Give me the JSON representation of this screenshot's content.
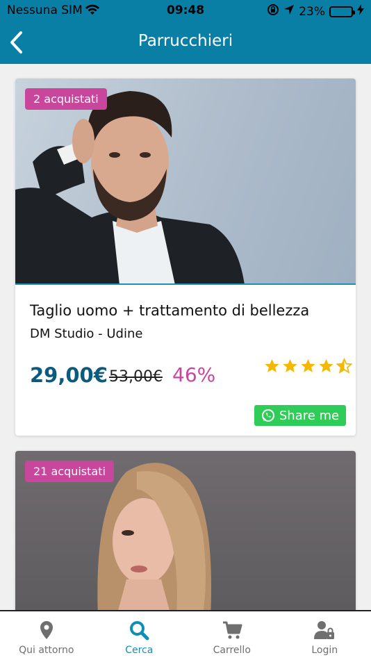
{
  "status_bar": {
    "carrier": "Nessuna SIM",
    "time": "09:48",
    "battery": "23%"
  },
  "header": {
    "title": "Parrucchieri",
    "back_icon": "chevron-left-icon"
  },
  "colors": {
    "brand": "#0a7fa6",
    "badge": "#c8469c",
    "price": "#0d5a7d",
    "share": "#2fcc57",
    "stars": "#f5b800",
    "tab_active": "#0f8fb8",
    "tab_inactive": "#6f6f6f"
  },
  "deals": [
    {
      "badge": "2 acquistati",
      "title": "Taglio uomo + trattamento di bellezza",
      "subtitle": "DM Studio - Udine",
      "price": "29,00€",
      "old_price": "53,00€",
      "discount": "46%",
      "rating": 4.5,
      "share_label": "Share me"
    },
    {
      "badge": "21 acquistati"
    }
  ],
  "tabs": [
    {
      "label": "Qui attorno",
      "icon": "map-pin-icon",
      "active": false
    },
    {
      "label": "Cerca",
      "icon": "search-icon",
      "active": true
    },
    {
      "label": "Carrello",
      "icon": "cart-icon",
      "active": false
    },
    {
      "label": "Login",
      "icon": "user-lock-icon",
      "active": false
    }
  ]
}
